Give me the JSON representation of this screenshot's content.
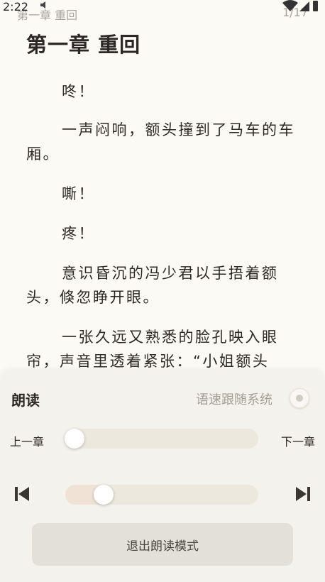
{
  "status_bar": {
    "time": "2:22",
    "chapter_title": "第一章 重回",
    "page_indicator": "1/17"
  },
  "reader": {
    "chapter_heading": "第一章 重回",
    "paragraphs": [
      "咚！",
      "一声闷响，额头撞到了马车的车厢。",
      "嘶！",
      "疼！",
      "意识昏沉的冯少君以手捂着额头，倏忽睁开眼。",
      "一张久远又熟悉的脸孔映入眼帘，声音里透着紧张：“小姐额头"
    ]
  },
  "read_aloud_panel": {
    "title": "朗读",
    "speed_label": "语速跟随系统",
    "speed_toggle_on": false,
    "prev_chapter_label": "上一章",
    "next_chapter_label": "下一章",
    "chapter_progress_fraction": 0.0,
    "speed_slider_fraction": 0.17,
    "exit_button_label": "退出朗读模式"
  },
  "icons": {
    "prev": "skip-previous-icon",
    "next": "skip-next-icon"
  }
}
